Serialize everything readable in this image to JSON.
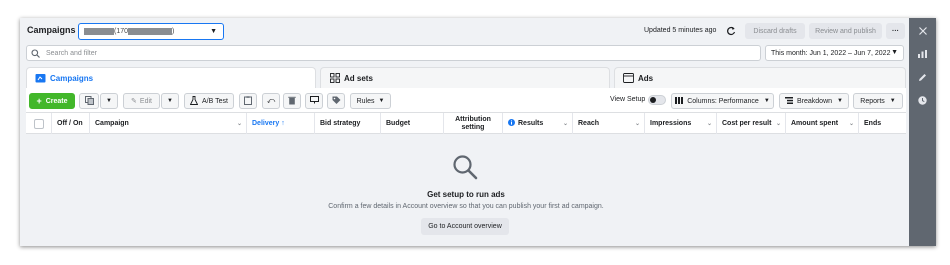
{
  "header": {
    "title": "Campaigns",
    "account_selector": {
      "prefix": "(170",
      "suffix": ")"
    },
    "updated_text": "Updated 5 minutes ago",
    "discard_label": "Discard drafts",
    "review_label": "Review and publish",
    "more_label": "···"
  },
  "search": {
    "placeholder": "Search and filter",
    "date_range": "This month: Jun 1, 2022 – Jun 7, 2022"
  },
  "tabs": [
    {
      "label": "Campaigns",
      "active": true,
      "icon": "folder-icon"
    },
    {
      "label": "Ad sets",
      "active": false,
      "icon": "grid-icon"
    },
    {
      "label": "Ads",
      "active": false,
      "icon": "ad-icon"
    }
  ],
  "toolbar": {
    "create_label": "Create",
    "edit_label": "Edit",
    "ab_test_label": "A/B Test",
    "rules_label": "Rules",
    "view_setup_label": "View Setup",
    "columns_label": "Columns: Performance",
    "breakdown_label": "Breakdown",
    "reports_label": "Reports"
  },
  "table": {
    "columns": [
      "Off / On",
      "Campaign",
      "Delivery",
      "Bid strategy",
      "Budget",
      "Attribution setting",
      "Results",
      "Reach",
      "Impressions",
      "Cost per result",
      "Amount spent",
      "Ends"
    ],
    "sorted_column": "Delivery",
    "sort_indicator": "↑"
  },
  "empty_state": {
    "heading": "Get setup to run ads",
    "message": "Confirm a few details in Account overview so that you can publish your first ad campaign.",
    "button_label": "Go to Account overview"
  },
  "colors": {
    "accent": "#1877f2",
    "create_green": "#42b72a",
    "right_sidebar": "#606770"
  }
}
